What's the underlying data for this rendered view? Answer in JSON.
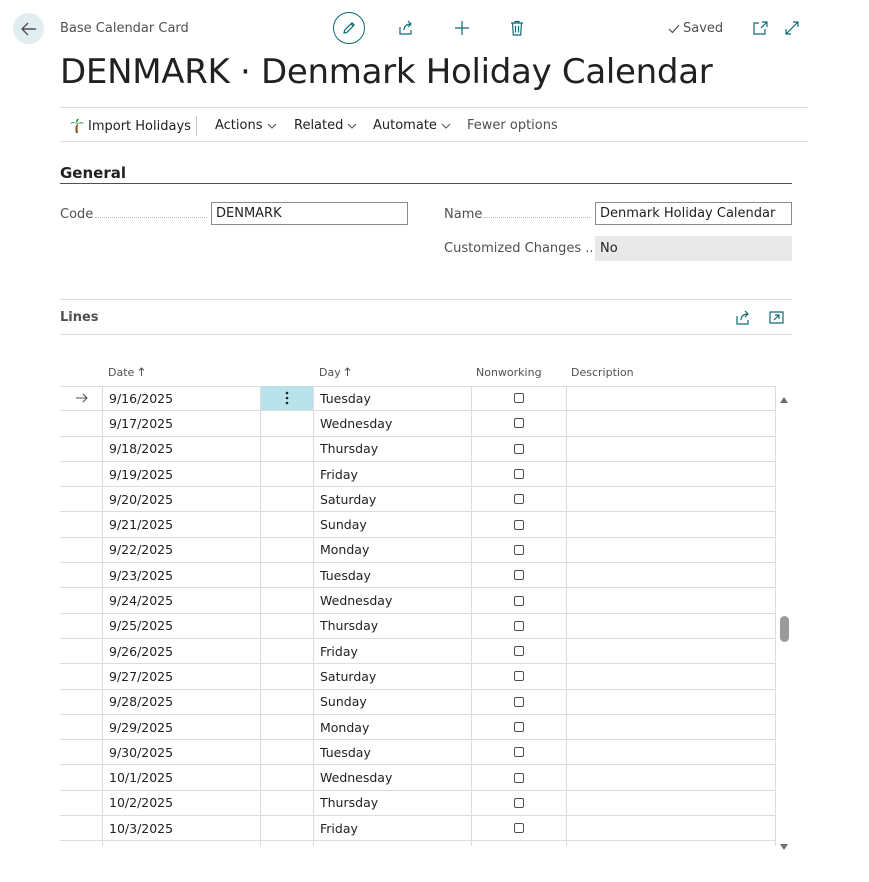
{
  "header": {
    "page_type": "Base Calendar Card",
    "title": "DENMARK · Denmark Holiday Calendar",
    "saved_label": "Saved"
  },
  "actions": {
    "import_holidays": "Import Holidays",
    "actions": "Actions",
    "related": "Related",
    "automate": "Automate",
    "fewer_options": "Fewer options"
  },
  "general": {
    "section_title": "General",
    "code_label": "Code",
    "code_value": "DENMARK",
    "name_label": "Name",
    "name_value": "Denmark Holiday Calendar",
    "customized_label": "Customized Changes ...",
    "customized_value": "No"
  },
  "lines": {
    "section_title": "Lines",
    "columns": {
      "date": "Date",
      "day": "Day",
      "nonworking": "Nonworking",
      "description": "Description"
    },
    "rows": [
      {
        "date": "9/16/2025",
        "day": "Tuesday",
        "nonworking": false,
        "description": ""
      },
      {
        "date": "9/17/2025",
        "day": "Wednesday",
        "nonworking": false,
        "description": ""
      },
      {
        "date": "9/18/2025",
        "day": "Thursday",
        "nonworking": false,
        "description": ""
      },
      {
        "date": "9/19/2025",
        "day": "Friday",
        "nonworking": false,
        "description": ""
      },
      {
        "date": "9/20/2025",
        "day": "Saturday",
        "nonworking": false,
        "description": ""
      },
      {
        "date": "9/21/2025",
        "day": "Sunday",
        "nonworking": false,
        "description": ""
      },
      {
        "date": "9/22/2025",
        "day": "Monday",
        "nonworking": false,
        "description": ""
      },
      {
        "date": "9/23/2025",
        "day": "Tuesday",
        "nonworking": false,
        "description": ""
      },
      {
        "date": "9/24/2025",
        "day": "Wednesday",
        "nonworking": false,
        "description": ""
      },
      {
        "date": "9/25/2025",
        "day": "Thursday",
        "nonworking": false,
        "description": ""
      },
      {
        "date": "9/26/2025",
        "day": "Friday",
        "nonworking": false,
        "description": ""
      },
      {
        "date": "9/27/2025",
        "day": "Saturday",
        "nonworking": false,
        "description": ""
      },
      {
        "date": "9/28/2025",
        "day": "Sunday",
        "nonworking": false,
        "description": ""
      },
      {
        "date": "9/29/2025",
        "day": "Monday",
        "nonworking": false,
        "description": ""
      },
      {
        "date": "9/30/2025",
        "day": "Tuesday",
        "nonworking": false,
        "description": ""
      },
      {
        "date": "10/1/2025",
        "day": "Wednesday",
        "nonworking": false,
        "description": ""
      },
      {
        "date": "10/2/2025",
        "day": "Thursday",
        "nonworking": false,
        "description": ""
      },
      {
        "date": "10/3/2025",
        "day": "Friday",
        "nonworking": false,
        "description": ""
      }
    ]
  },
  "colors": {
    "accent": "#0f6a73",
    "selected_cell": "#b8e3ea",
    "back_button_bg": "#e1eef1"
  },
  "icons": [
    "back-arrow-icon",
    "pencil-icon",
    "share-icon",
    "plus-icon",
    "trash-icon",
    "check-icon",
    "open-new-window-icon",
    "expand-icon",
    "palm-tree-icon",
    "chevron-down-icon",
    "sort-up-icon",
    "row-arrow-icon",
    "more-vertical-icon",
    "scroll-up-icon",
    "scroll-down-icon"
  ]
}
